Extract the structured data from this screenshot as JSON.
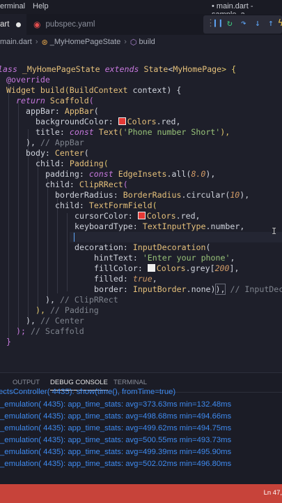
{
  "menu": {
    "item_1": "erminal",
    "item_2": "Help",
    "window_title": "• main.dart - sample_a"
  },
  "tabs": [
    {
      "label": "art",
      "active": true
    },
    {
      "label": "pubspec.yaml",
      "active": false
    }
  ],
  "breadcrumb": [
    "main.dart",
    "_MyHomePageState",
    "build"
  ],
  "code": {
    "l1": {
      "a": "lass",
      "b": "_MyHomePageState",
      "c": "extends",
      "d": "State",
      "e": "<",
      "f": "MyHomePage",
      "g": "> {"
    },
    "l2": "@override",
    "l3": {
      "a": "Widget",
      "b": "build",
      "c": "(",
      "d": "BuildContext",
      "e": " context) {"
    },
    "l4": {
      "a": "return",
      "b": "Scaffold",
      "c": "("
    },
    "l5": {
      "a": "appBar: ",
      "b": "AppBar",
      "c": "("
    },
    "l6": {
      "a": "backgroundColor: ",
      "b": "Colors",
      "c": ".red,"
    },
    "l7": {
      "a": "title: ",
      "b": "const",
      "c": "Text",
      "d": "(",
      "e": "'Phone number Short'",
      "f": "),"
    },
    "l8": {
      "a": "), ",
      "b": "// AppBar"
    },
    "l9": {
      "a": "body: ",
      "b": "Center",
      "c": "("
    },
    "l10": {
      "a": "child: ",
      "b": "Padding",
      "c": "("
    },
    "l11": {
      "a": "padding: ",
      "b": "const",
      "c": "EdgeInsets",
      "d": ".all(",
      "e": "8.0",
      "f": "),"
    },
    "l12": {
      "a": "child: ",
      "b": "ClipRRect",
      "c": "("
    },
    "l13": {
      "a": "borderRadius: ",
      "b": "BorderRadius",
      "c": ".circular(",
      "d": "10",
      "e": "),"
    },
    "l14": {
      "a": "child: ",
      "b": "TextFormField",
      "c": "("
    },
    "l15": {
      "a": "cursorColor: ",
      "b": "Colors",
      "c": ".red,"
    },
    "l16": {
      "a": "keyboardType: ",
      "b": "TextInputType",
      "c": ".number,"
    },
    "l18": {
      "a": "decoration: ",
      "b": "InputDecoration",
      "c": "("
    },
    "l19": {
      "a": "hintText: ",
      "b": "'Enter your phone'",
      "c": ","
    },
    "l20": {
      "a": "fillColor: ",
      "b": "Colors",
      "c": ".grey[",
      "d": "200",
      "e": "],"
    },
    "l21": {
      "a": "filled: ",
      "b": "true",
      "c": ","
    },
    "l22": {
      "a": "border: ",
      "b": "InputBorder",
      "c": ".none)",
      "d": "),",
      "e": "// InputDec"
    },
    "l23": {
      "a": "), ",
      "b": "// ClipRRect"
    },
    "l24": {
      "a": "), ",
      "b": "// Padding"
    },
    "l25": {
      "a": "), ",
      "b": "// Center"
    },
    "l26": {
      "a": "); ",
      "b": "// Scaffold"
    },
    "l27": "}"
  },
  "colors": {
    "red_swatch": "#e53935",
    "grey_swatch": "#eeeeee"
  },
  "panel": {
    "tabs": [
      "OUTPUT",
      "DEBUG CONSOLE",
      "TERMINAL"
    ],
    "logs": [
      "ectsController( 4435): show(time(), fromTime=true)",
      "_emulation( 4435): app_time_stats: avg=373.63ms min=132.48ms",
      "_emulation( 4435): app_time_stats: avg=498.68ms min=494.66ms",
      "_emulation( 4435): app_time_stats: avg=499.62ms min=494.75ms",
      "_emulation( 4435): app_time_stats: avg=500.55ms min=493.73ms",
      "_emulation( 4435): app_time_stats: avg=499.39ms min=495.90ms",
      "_emulation( 4435): app_time_stats: avg=502.02ms min=496.80ms"
    ]
  },
  "status": {
    "position": "Ln 47,"
  }
}
